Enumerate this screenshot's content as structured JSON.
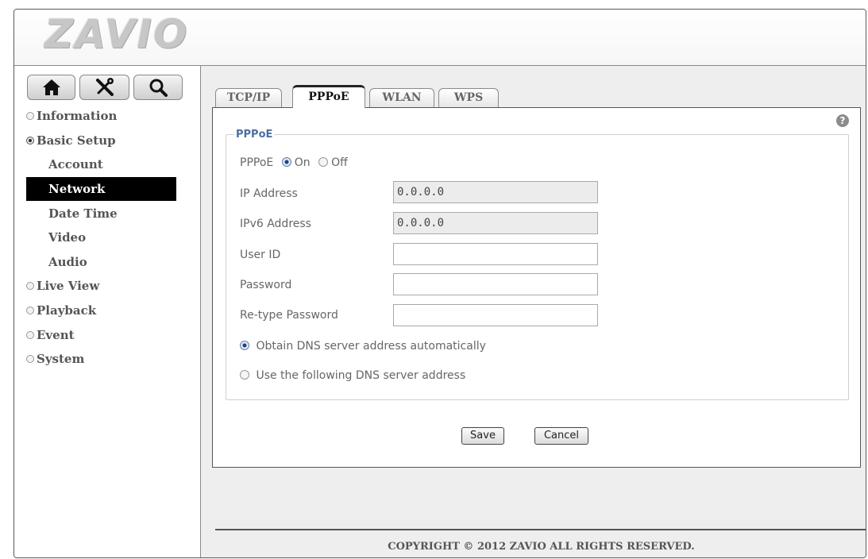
{
  "brand": {
    "logo_text": "ZAVIO"
  },
  "toolbar": {
    "icons": [
      "home-icon",
      "tools-icon",
      "search-icon"
    ]
  },
  "sidebar": {
    "items": [
      {
        "label": "Information",
        "type": "section",
        "expanded": false
      },
      {
        "label": "Basic Setup",
        "type": "section",
        "expanded": true
      },
      {
        "label": "Account",
        "type": "sub",
        "active": false
      },
      {
        "label": "Network",
        "type": "sub",
        "active": true
      },
      {
        "label": "Date Time",
        "type": "sub",
        "active": false
      },
      {
        "label": "Video",
        "type": "sub",
        "active": false
      },
      {
        "label": "Audio",
        "type": "sub",
        "active": false
      },
      {
        "label": "Live View",
        "type": "section",
        "expanded": false
      },
      {
        "label": "Playback",
        "type": "section",
        "expanded": false
      },
      {
        "label": "Event",
        "type": "section",
        "expanded": false
      },
      {
        "label": "System",
        "type": "section",
        "expanded": false
      }
    ]
  },
  "tabs": [
    {
      "label": "TCP/IP",
      "active": false
    },
    {
      "label": "PPPoE",
      "active": true
    },
    {
      "label": "WLAN",
      "active": false
    },
    {
      "label": "WPS",
      "active": false
    }
  ],
  "form": {
    "legend": "PPPoE",
    "pppoe_label": "PPPoE",
    "on_label": "On",
    "off_label": "Off",
    "pppoe_state": "On",
    "ip_label": "IP Address",
    "ip_value": "0.0.0.0",
    "ipv6_label": "IPv6 Address",
    "ipv6_value": "0.0.0.0",
    "userid_label": "User ID",
    "userid_value": "",
    "password_label": "Password",
    "password_value": "",
    "retype_label": "Re-type Password",
    "retype_value": "",
    "dns_auto_label": "Obtain DNS server address automatically",
    "dns_manual_label": "Use the following DNS server address",
    "dns_mode": "auto"
  },
  "buttons": {
    "save": "Save",
    "cancel": "Cancel"
  },
  "footer": {
    "copyright": "COPYRIGHT © 2012 ZAVIO ALL RIGHTS RESERVED."
  },
  "colors": {
    "legend": "#4b6fa3",
    "active_nav_bg": "#000000",
    "radio_checked": "#1f3f8a"
  }
}
